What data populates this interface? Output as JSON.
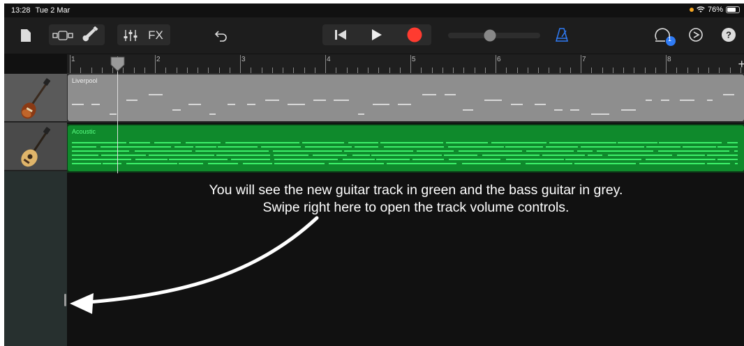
{
  "status_bar": {
    "time": "13:28",
    "date": "Tue 2 Mar",
    "battery_percent": "76%",
    "battery_level": 0.76,
    "icons": [
      "orange-dot-indicator",
      "wifi-icon",
      "battery-icon"
    ]
  },
  "toolbar": {
    "fx_label": "FX",
    "notification_count": "1",
    "record_color": "#ff3b30",
    "metronome_color": "#2f7bf5",
    "master_volume_level": 0.5,
    "icons": [
      "document-icon",
      "view-toggle-icon",
      "guitar-instrument-icon",
      "mixer-icon",
      "undo-icon",
      "go-to-beginning-icon",
      "play-icon",
      "record-icon",
      "metronome-icon",
      "loop-browser-icon",
      "settings-icon",
      "help-icon"
    ]
  },
  "ruler": {
    "bars": [
      "1",
      "2",
      "3",
      "4",
      "5",
      "6",
      "7",
      "8"
    ],
    "plus_label": "+"
  },
  "tracks": [
    {
      "name": "Liverpool",
      "instrument": "bass-guitar",
      "color": "#8e8e8e",
      "note_color": "#d8d8d8"
    },
    {
      "name": "Acoustic",
      "instrument": "acoustic-guitar",
      "color": "#0f8a2c",
      "note_color": "#3cf06a"
    }
  ],
  "instruction": {
    "line1": "You will see the new guitar track in green and the bass guitar in grey.",
    "line2": "Swipe right here to open the track volume controls."
  }
}
